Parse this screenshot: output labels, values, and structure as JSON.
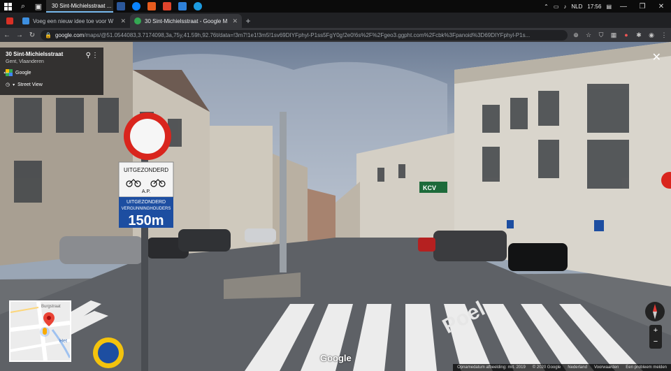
{
  "taskbar": {
    "active_app_label": "30 Sint-Michielsstraat ...",
    "tray": {
      "language": "NLD",
      "time": "17:56"
    }
  },
  "browser": {
    "tabs": [
      {
        "label": "Voeg een nieuw idee toe voor W",
        "favicon_color": "#3d8fe0"
      },
      {
        "label": "30 Sint-Michielsstraat - Google M",
        "favicon_color": "#34a853"
      }
    ],
    "url": {
      "host": "google.com",
      "path": "/maps/@51.0544083,3.7174098,3a,75y,41.59h,92.76t/data=!3m7!1e1!3m5!1sv69DIYFphyl-P1ss5FgY0g!2e0!6s%2F%2Fgeo3.ggpht.com%2Fcbk%3Fpanoid%3D69DIYFphyl-P1s..."
    }
  },
  "streetview": {
    "address": "30 Sint-Michielsstraat",
    "city": "Gent, Vlaanderen",
    "provider": "Google",
    "mode": "Street View",
    "watermark": "Google",
    "minimap_label": "Burgstraat",
    "minimap_label2": "Het",
    "signs": {
      "except_top": "UITGEZONDERD",
      "bike_caption": "A.P.",
      "except_bottom_1": "UITGEZONDERD",
      "except_bottom_2": "VERGUNNINGHOUDERS",
      "distance": "150m",
      "road_paint": "Poel",
      "kcv": "KCV"
    },
    "footer": [
      "Opnamedatum afbeelding: mrt. 2019",
      "© 2020 Google",
      "Nederland",
      "Voorwaarden",
      "Een probleem melden"
    ]
  },
  "colors": {
    "taskbar": "#0b0b0b",
    "chrome_dark": "#202124",
    "chrome_toolbar": "#35363a",
    "accent": "#76b9ed"
  }
}
